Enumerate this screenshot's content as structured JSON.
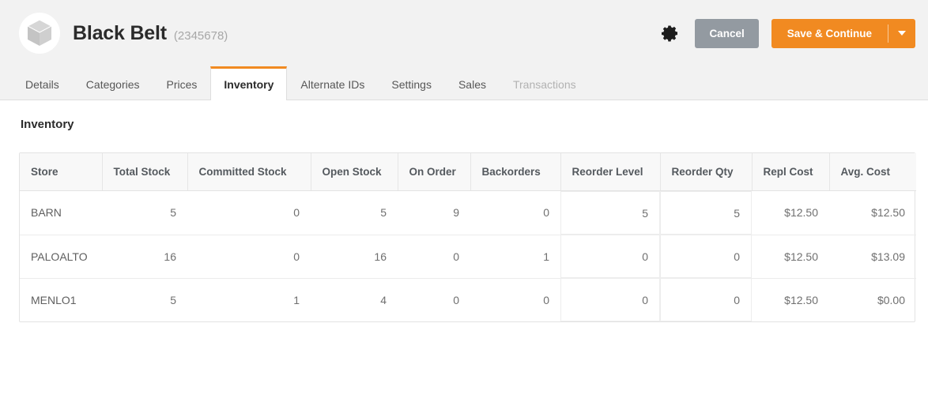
{
  "header": {
    "logo_icon": "cube-icon",
    "product_title": "Black Belt",
    "product_sku": "(2345678)",
    "gear_icon": "gear-icon",
    "cancel_label": "Cancel",
    "save_label": "Save & Continue",
    "caret_icon": "chevron-down-icon",
    "accent_color": "#f18a21",
    "cancel_color": "#939aa1"
  },
  "tabs": [
    {
      "label": "Details",
      "active": false,
      "disabled": false
    },
    {
      "label": "Categories",
      "active": false,
      "disabled": false
    },
    {
      "label": "Prices",
      "active": false,
      "disabled": false
    },
    {
      "label": "Inventory",
      "active": true,
      "disabled": false
    },
    {
      "label": "Alternate IDs",
      "active": false,
      "disabled": false
    },
    {
      "label": "Settings",
      "active": false,
      "disabled": false
    },
    {
      "label": "Sales",
      "active": false,
      "disabled": false
    },
    {
      "label": "Transactions",
      "active": false,
      "disabled": true
    }
  ],
  "main": {
    "section_title": "Inventory",
    "table": {
      "columns": [
        "Store",
        "Total Stock",
        "Committed Stock",
        "Open Stock",
        "On Order",
        "Backorders",
        "Reorder Level",
        "Reorder Qty",
        "Repl Cost",
        "Avg. Cost"
      ],
      "rows": [
        {
          "store": "BARN",
          "total_stock": "5",
          "committed_stock": "0",
          "open_stock": "5",
          "on_order": "9",
          "backorders": "0",
          "reorder_level": "5",
          "reorder_qty": "5",
          "repl_cost": "$12.50",
          "avg_cost": "$12.50"
        },
        {
          "store": "PALOALTO",
          "total_stock": "16",
          "committed_stock": "0",
          "open_stock": "16",
          "on_order": "0",
          "backorders": "1",
          "reorder_level": "0",
          "reorder_qty": "0",
          "repl_cost": "$12.50",
          "avg_cost": "$13.09"
        },
        {
          "store": "MENLO1",
          "total_stock": "5",
          "committed_stock": "1",
          "open_stock": "4",
          "on_order": "0",
          "backorders": "0",
          "reorder_level": "0",
          "reorder_qty": "0",
          "repl_cost": "$12.50",
          "avg_cost": "$0.00"
        }
      ]
    }
  }
}
